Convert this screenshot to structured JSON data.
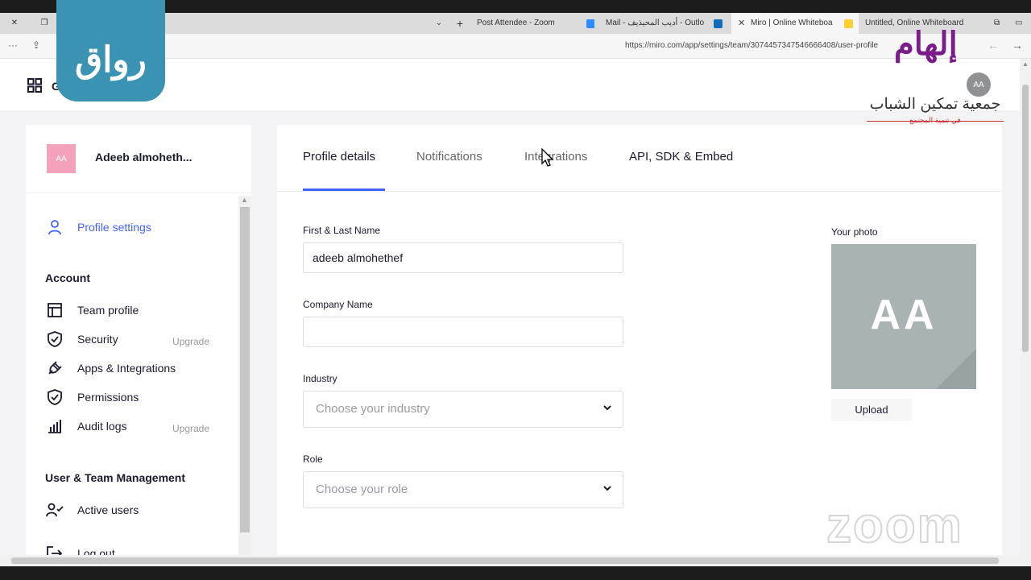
{
  "browser": {
    "tabs": [
      {
        "label": "Post Attendee - Zoom"
      },
      {
        "label": "Mail - أديب المحيذيف - Outlo"
      },
      {
        "label": "Miro | Online Whiteboa"
      },
      {
        "label": "Untitled, Online Whiteboard"
      }
    ],
    "url": "https://miro.com/app/settings/team/3074457347546666408/user-profile"
  },
  "header": {
    "go_back": "Go t"
  },
  "sidebar": {
    "avatar_initials": "AA",
    "user_name": "Adeeb almoheth...",
    "profile_settings": "Profile settings",
    "account_heading": "Account",
    "items": [
      {
        "label": "Team profile"
      },
      {
        "label": "Security",
        "badge": "Upgrade"
      },
      {
        "label": "Apps & Integrations"
      },
      {
        "label": "Permissions"
      },
      {
        "label": "Audit logs",
        "badge": "Upgrade"
      }
    ],
    "management_heading": "User & Team Management",
    "active_users": "Active users",
    "logout": "Log out"
  },
  "main": {
    "tabs": [
      {
        "label": "Profile details",
        "active": true
      },
      {
        "label": "Notifications"
      },
      {
        "label": "Integrations"
      },
      {
        "label": "API, SDK & Embed"
      }
    ],
    "name_label": "First & Last Name",
    "name_value": "adeeb almohethef",
    "company_label": "Company Name",
    "company_value": "",
    "industry_label": "Industry",
    "industry_placeholder": "Choose your industry",
    "role_label": "Role",
    "role_placeholder": "Choose your role",
    "photo_label": "Your photo",
    "photo_initials": "AA",
    "upload_label": "Upload"
  },
  "overlays": {
    "rewaq_logo": "رواق",
    "association_brand": "إلهام",
    "association_name": "جمعية تمكين الشباب",
    "association_sub": "في تنمية المجتمع",
    "association_avatar": "AA",
    "zoom_watermark": "zoom"
  },
  "colors": {
    "accent": "#4262ff",
    "avatar_pink": "#f4a1bb",
    "photo_gray": "#aab3b4",
    "rewaq_teal": "#3a93b3"
  }
}
